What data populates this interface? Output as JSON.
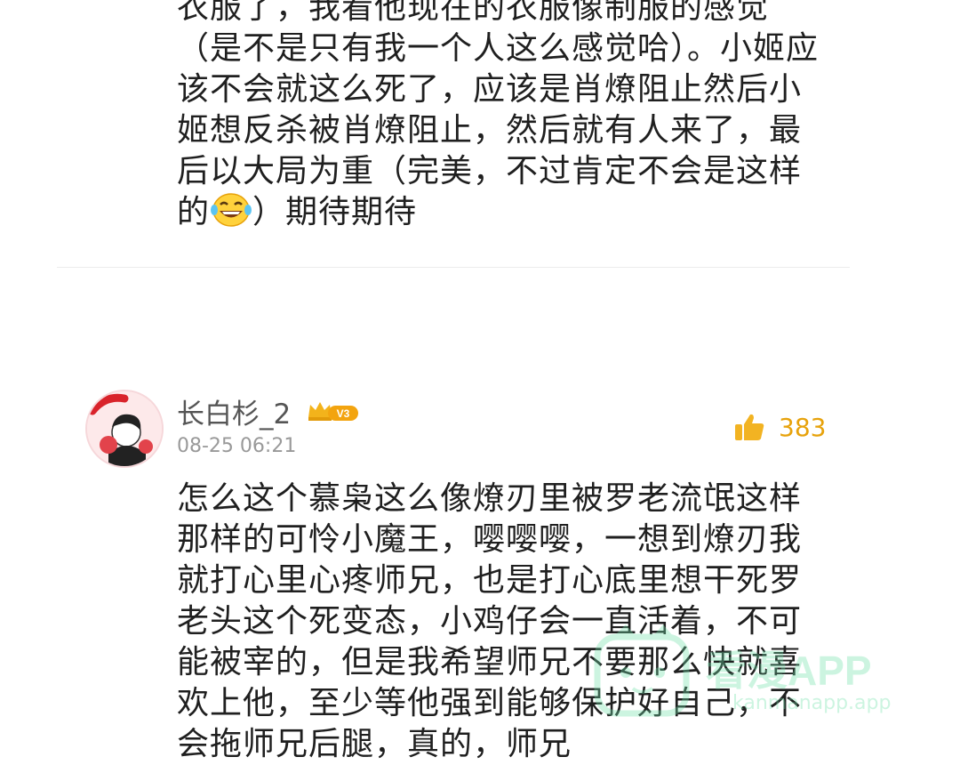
{
  "previous_comment": {
    "text_before_emoji": "衣服了，我看他现在的衣服像制服的感觉（是不是只有我一个人这么感觉哈）。小姬应该不会就这么死了，应该是肖燎阻止然后小姬想反杀被肖燎阻止，然后就有人来了，最后以大局为重（完美，不过肯定不会是这样的",
    "emoji": "laughing-tears-emoji",
    "text_after_emoji": "）期待期待"
  },
  "comment": {
    "username": "长白杉_2",
    "vip_level": "V3",
    "timestamp": "08-25 06:21",
    "like_count": "383",
    "text": "怎么这个慕枭这么像燎刃里被罗老流氓这样那样的可怜小魔王，嘤嘤嘤，一想到燎刃我就打心里心疼师兄，也是打心底里想干死罗老头这个死变态，小鸡仔会一直活着，不可能被宰的，但是我希望师兄不要那么快就喜欢上他，至少等他强到能够保护好自己，不会拖师兄后腿，真的，师兄"
  },
  "watermark": {
    "title": "看漫APP",
    "subtitle": "kanmanapp.app"
  },
  "colors": {
    "text": "#1f1f1f",
    "meta": "#999999",
    "like": "#e7a20b",
    "vip": "#f3a40f",
    "watermark": "#6fe0a8"
  }
}
